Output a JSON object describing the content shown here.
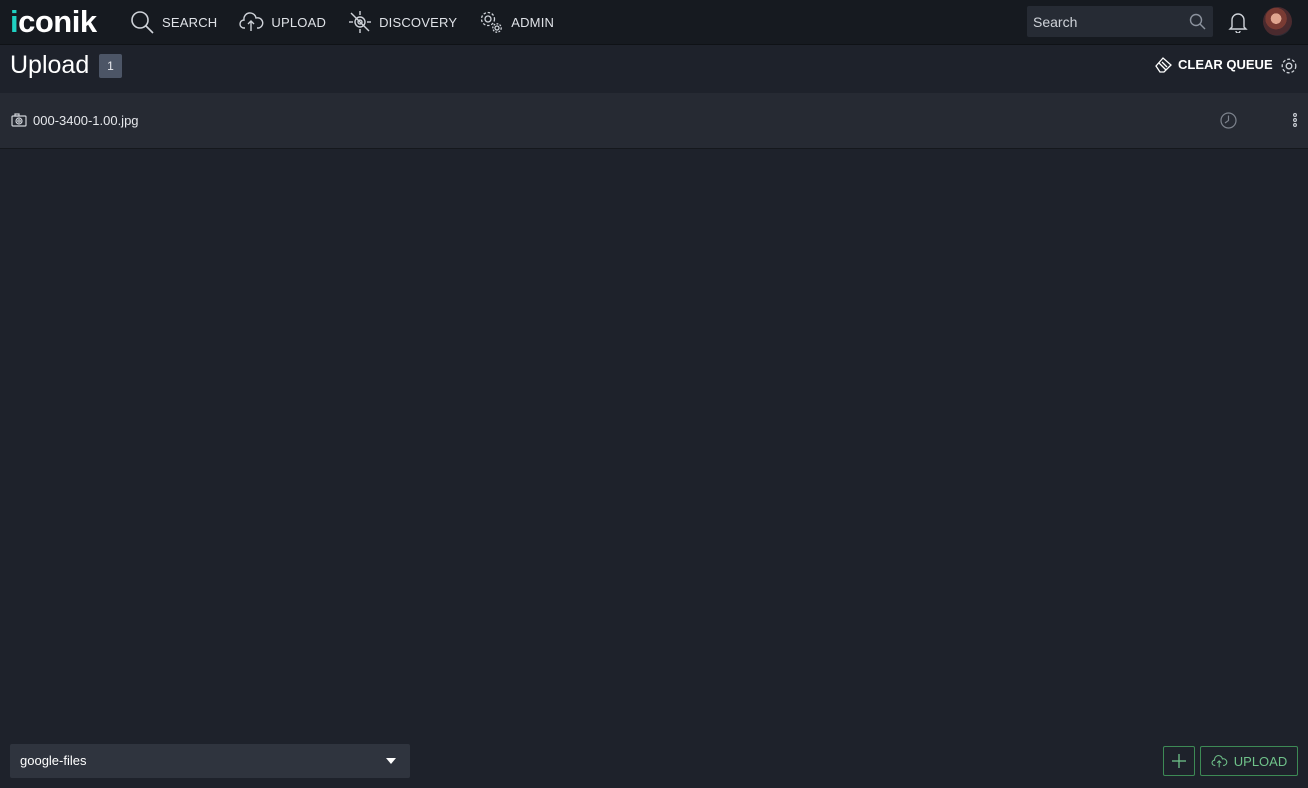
{
  "app": {
    "logo_text": "iconik"
  },
  "nav": {
    "items": [
      {
        "label": "SEARCH",
        "icon": "search-icon"
      },
      {
        "label": "UPLOAD",
        "icon": "cloud-upload-icon"
      },
      {
        "label": "DISCOVERY",
        "icon": "discovery-icon"
      },
      {
        "label": "ADMIN",
        "icon": "gears-icon"
      }
    ]
  },
  "header_search": {
    "placeholder": "Search"
  },
  "page": {
    "title": "Upload",
    "count": "1",
    "clear_queue_label": "CLEAR QUEUE"
  },
  "queue": {
    "items": [
      {
        "file_name": "000-3400-1.00.jpg",
        "type_icon": "camera-icon",
        "status_icon": "clock-icon"
      }
    ]
  },
  "footer": {
    "storage_selected": "google-files",
    "upload_label": "UPLOAD"
  },
  "colors": {
    "background": "#1e222b",
    "topbar": "#161a20",
    "row": "#262a33",
    "accent_teal": "#1fd1c2",
    "upload_green": "#6fc28a"
  }
}
